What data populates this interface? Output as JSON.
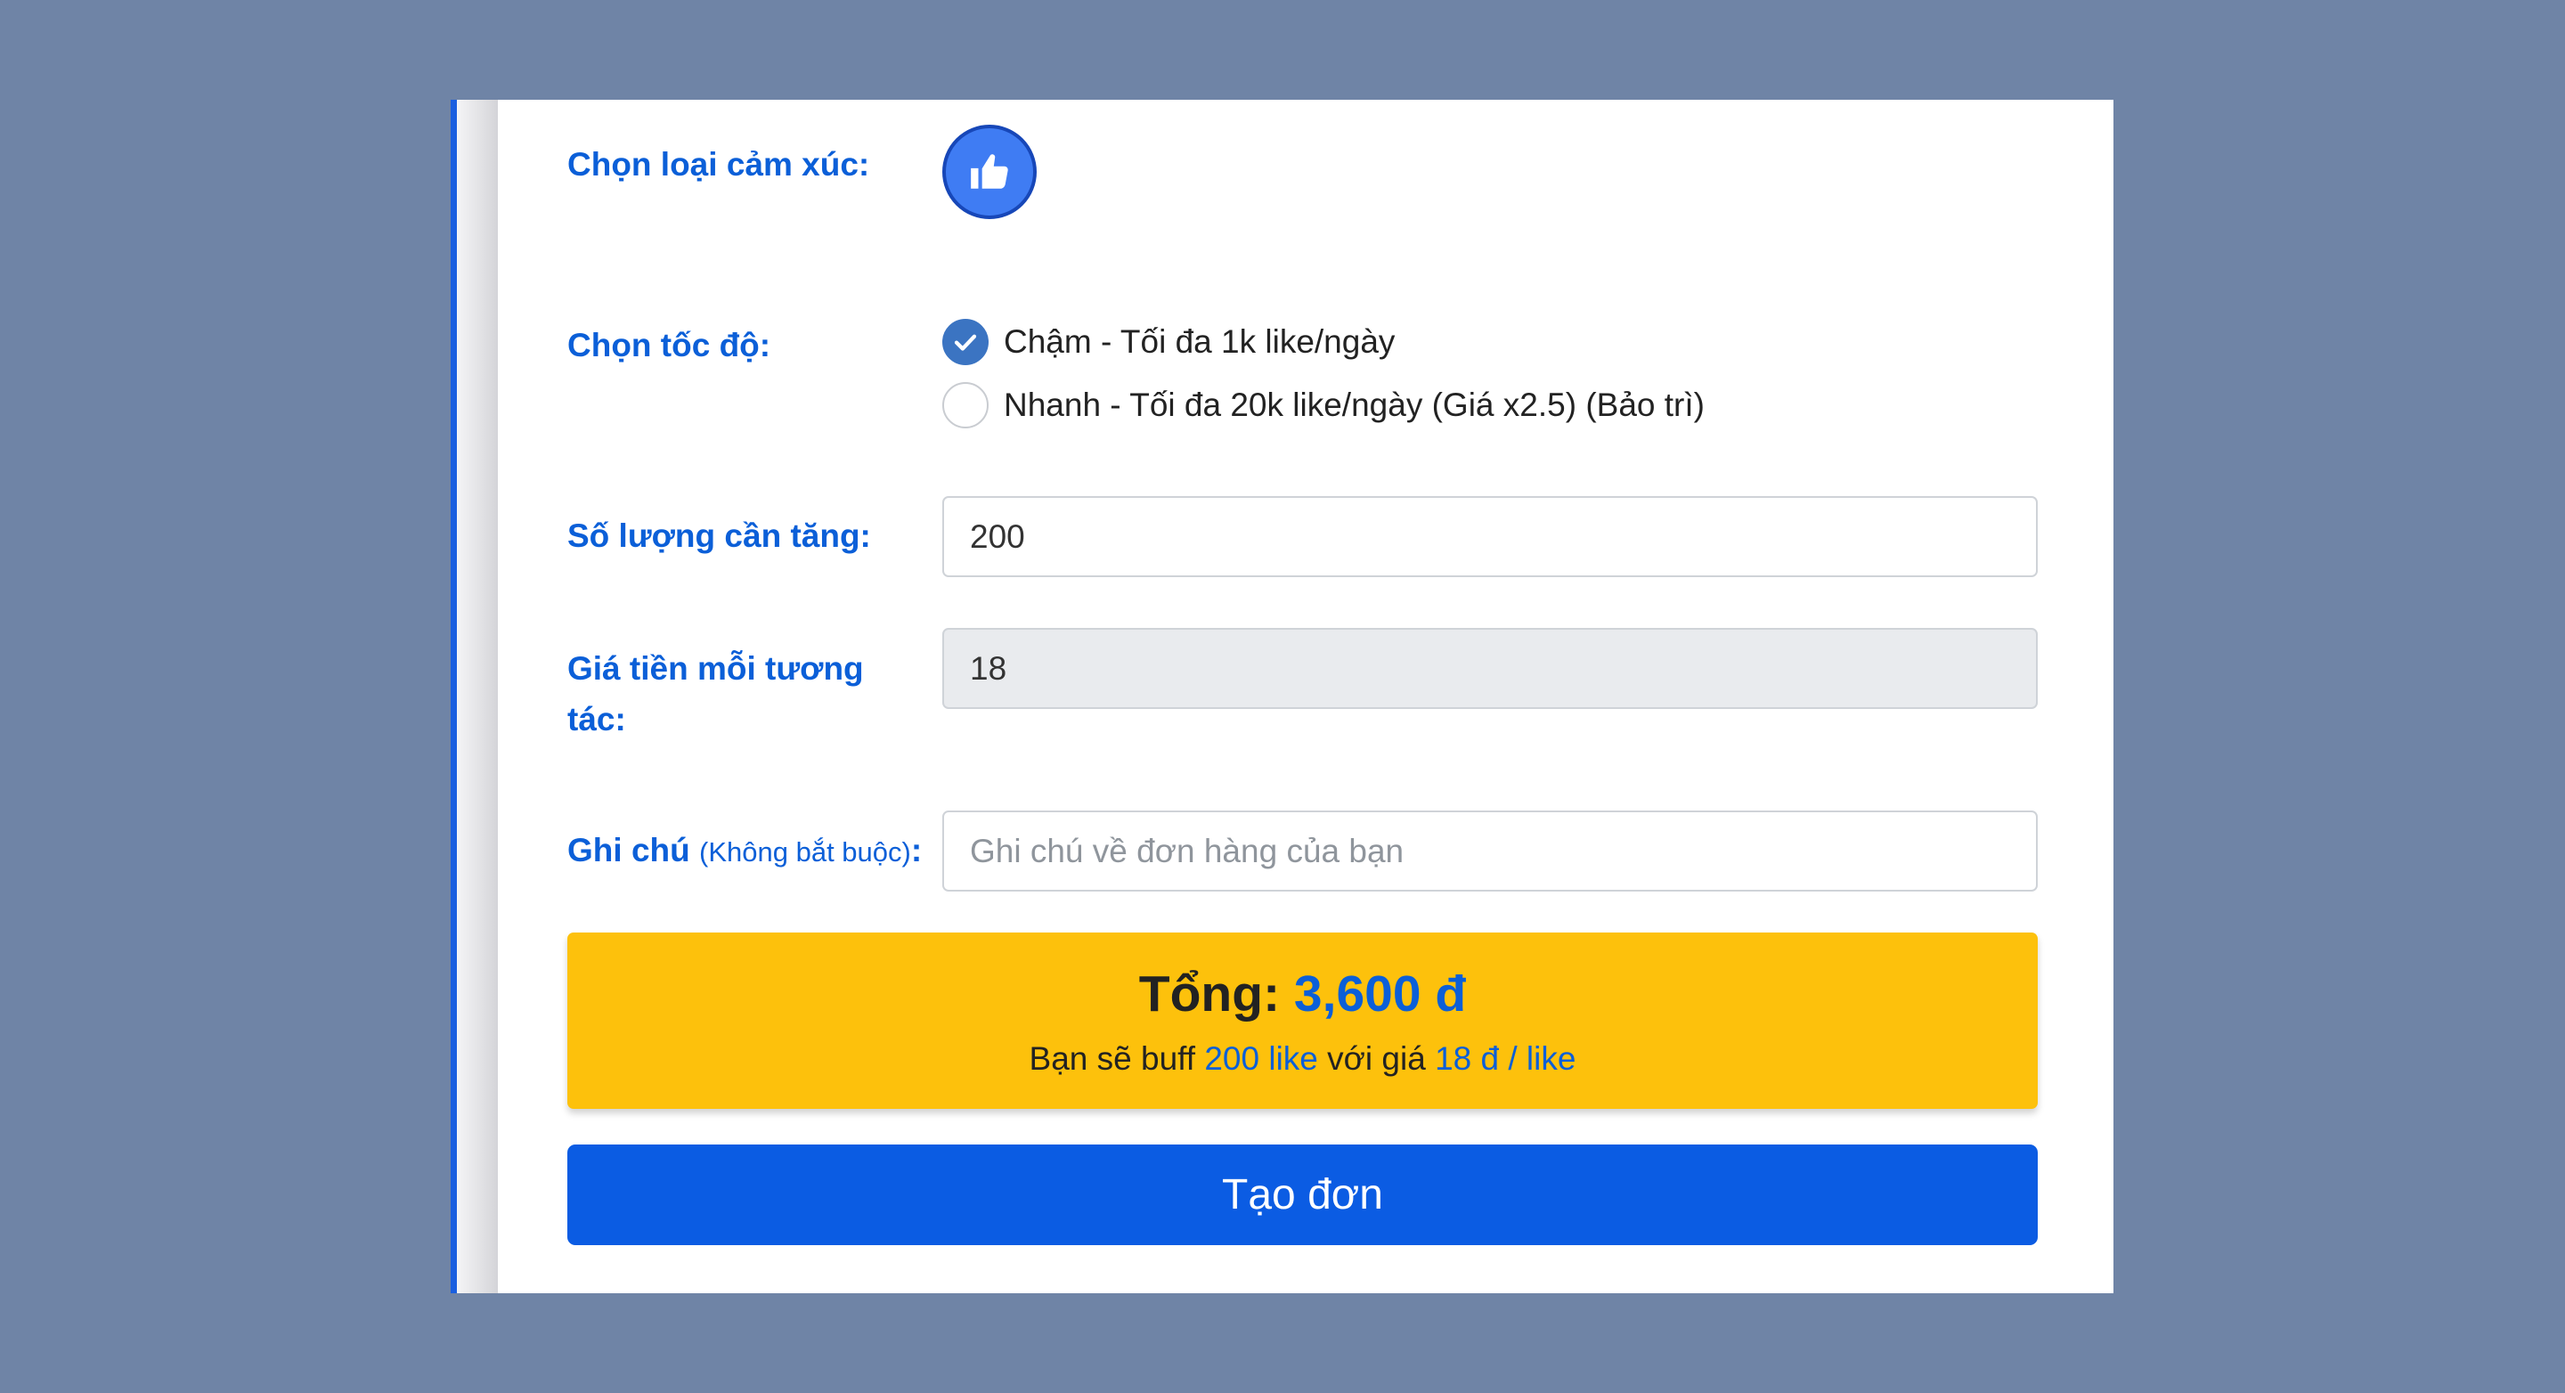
{
  "form": {
    "reaction_label": "Chọn loại cảm xúc:",
    "speed_label": "Chọn tốc độ:",
    "speed_options": [
      {
        "label": "Chậm - Tối đa 1k like/ngày",
        "selected": true
      },
      {
        "label": "Nhanh - Tối đa 20k like/ngày (Giá x2.5) (Bảo trì)",
        "selected": false
      }
    ],
    "quantity_label": "Số lượng cần tăng:",
    "quantity_value": "200",
    "price_label_line1": "Giá tiền mỗi tương",
    "price_label_line2": "tác:",
    "price_value": "18",
    "note_label": "Ghi chú",
    "note_label_hint": "(Không bắt buộc)",
    "note_label_colon": ":",
    "note_placeholder": "Ghi chú về đơn hàng của bạn"
  },
  "summary": {
    "total_label": "Tổng:",
    "total_amount": "3,600 đ",
    "detail_prefix": "Bạn sẽ buff",
    "detail_quantity": "200 like",
    "detail_middle": "với giá",
    "detail_price": "18 đ / like"
  },
  "submit_label": "Tạo đơn",
  "icons": {
    "reaction": "thumbs-up-icon",
    "checked": "check-icon"
  },
  "colors": {
    "accent": "#0b5fd8",
    "button": "#0b5ce3",
    "total_bg": "#fdc10c",
    "page_bg": "#6f84a6"
  }
}
